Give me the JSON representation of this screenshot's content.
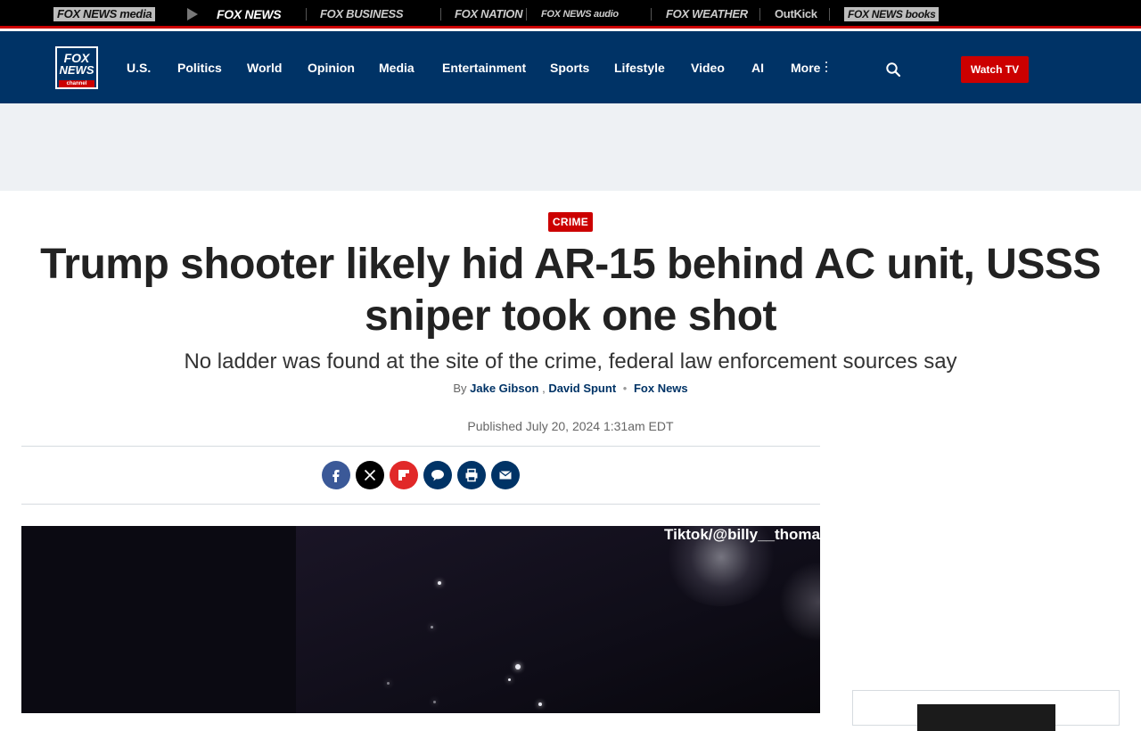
{
  "network_bar": {
    "brands": [
      {
        "label": "FOX NEWS media"
      },
      {
        "label": "FOX NEWS"
      },
      {
        "label": "FOX BUSINESS"
      },
      {
        "label": "FOX NATION"
      },
      {
        "label": "FOX NEWS audio"
      },
      {
        "label": "FOX WEATHER"
      },
      {
        "label": "OutKick"
      },
      {
        "label": "FOX NEWS books"
      }
    ]
  },
  "nav": {
    "logo": {
      "line1": "FOX",
      "line2": "NEWS",
      "line3": "channel"
    },
    "items": [
      "U.S.",
      "Politics",
      "World",
      "Opinion",
      "Media",
      "Entertainment",
      "Sports",
      "Lifestyle",
      "Video",
      "AI",
      "More"
    ],
    "watch_tv": "Watch TV"
  },
  "article": {
    "category": "CRIME",
    "headline": "Trump shooter likely hid AR-15 behind AC unit, USSS sniper took one shot",
    "subhead": "No ladder was found at the site of the crime, federal law enforcement sources say",
    "byline_prefix": "By",
    "authors": [
      "Jake Gibson",
      "David Spunt"
    ],
    "author_sep": ",",
    "source": "Fox News",
    "published": "Published July 20, 2024 1:31am EDT"
  },
  "share": {
    "icons": [
      "facebook-icon",
      "x-icon",
      "flipboard-icon",
      "comments-icon",
      "print-icon",
      "email-icon"
    ],
    "colors": {
      "facebook": "#3b5998",
      "x": "#000000",
      "flipboard": "#e12828",
      "comments": "#003366",
      "print": "#003366",
      "email": "#003366"
    }
  },
  "video": {
    "watermark": "Tiktok/@billy__thoma"
  },
  "colors": {
    "nav_bg": "#003366",
    "accent_red": "#cc0000",
    "headline": "#222222"
  }
}
